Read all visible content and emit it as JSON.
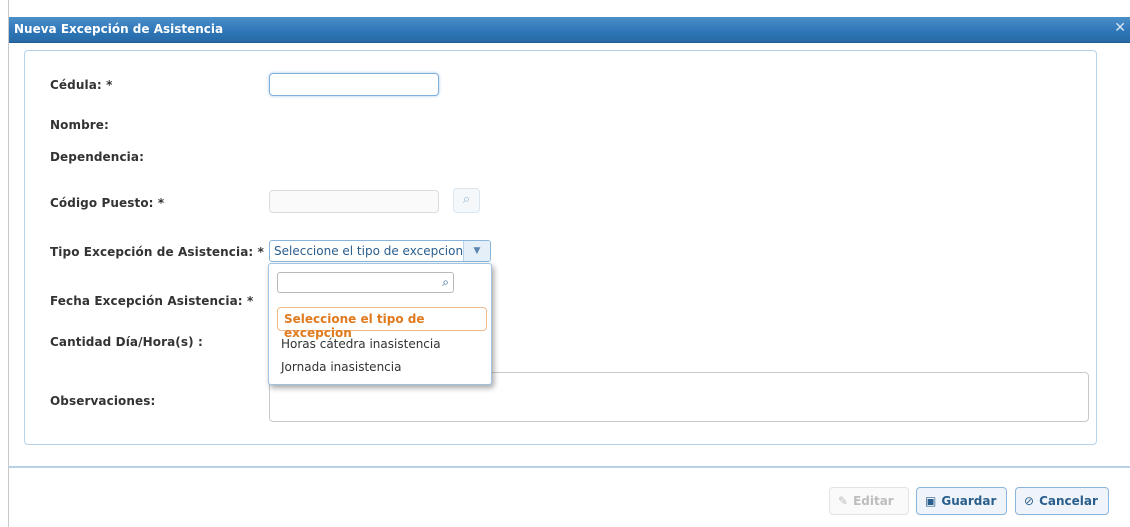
{
  "dialog": {
    "title": "Nueva Excepción de Asistencia",
    "close_icon": "close-icon"
  },
  "form": {
    "cedula_label": "Cédula: *",
    "cedula_value": "",
    "nombre_label": "Nombre:",
    "dependencia_label": "Dependencia:",
    "codigo_puesto_label": "Código Puesto: *",
    "codigo_puesto_value": "",
    "tipo_label": "Tipo Excepción de Asistencia: *",
    "tipo_selected": "Seleccione el tipo de excepcion",
    "fecha_label": "Fecha Excepción Asistencia: *",
    "cantidad_label": "Cantidad Día/Hora(s) :",
    "observaciones_label": "Observaciones:"
  },
  "dropdown": {
    "search_value": "",
    "options": [
      "Seleccione el tipo de excepcion",
      "Horas cátedra inasistencia",
      "Jornada inasistencia"
    ]
  },
  "footer": {
    "edit_label": "Editar",
    "save_label": "Guardar",
    "cancel_label": "Cancelar"
  },
  "colors": {
    "title_bar": "#2f77b8",
    "selected_option": "#e07a1f",
    "button_text": "#2a5e8c"
  }
}
